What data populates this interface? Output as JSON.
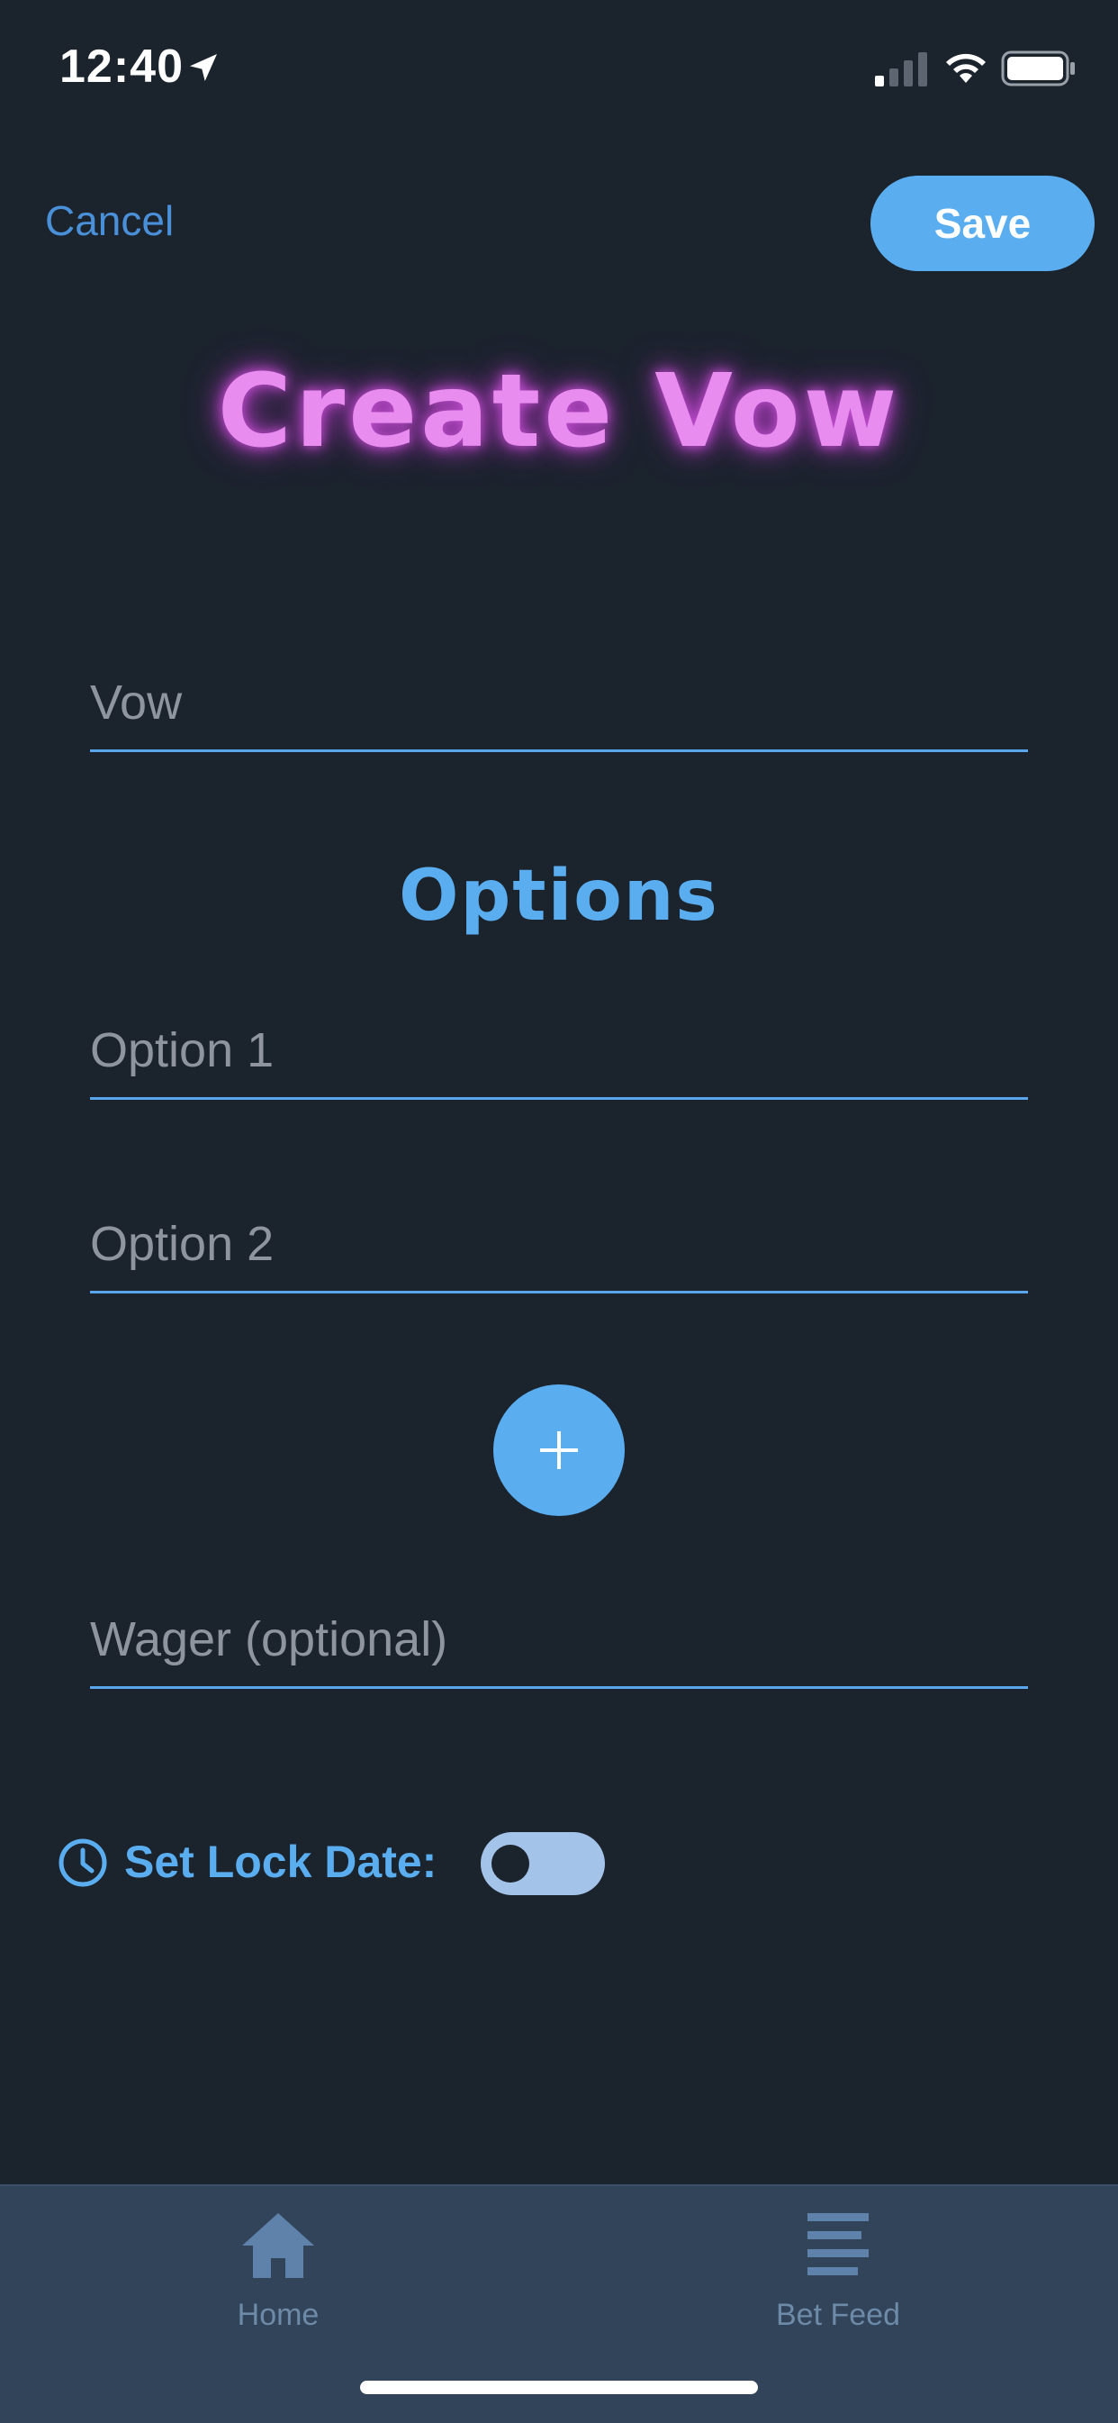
{
  "status_bar": {
    "time": "12:40",
    "icons": [
      "location-arrow-icon",
      "cellular-signal-icon",
      "wifi-icon",
      "battery-icon"
    ]
  },
  "header": {
    "cancel_label": "Cancel",
    "save_label": "Save"
  },
  "page": {
    "title": "Create Vow"
  },
  "form": {
    "vow_placeholder": "Vow",
    "options_heading": "Options",
    "option1_placeholder": "Option 1",
    "option2_placeholder": "Option 2",
    "add_option_icon": "plus-icon",
    "wager_placeholder": "Wager (optional)",
    "lock_date_label": "Set Lock Date:",
    "lock_date_enabled": false
  },
  "tab_bar": {
    "items": [
      {
        "label": "Home",
        "icon": "home-icon"
      },
      {
        "label": "Bet Feed",
        "icon": "feed-list-icon"
      }
    ]
  },
  "colors": {
    "background": "#1b232d",
    "accent": "#5aaef0",
    "title_glow": "#e98cf0",
    "tab_bar": "#324459"
  }
}
